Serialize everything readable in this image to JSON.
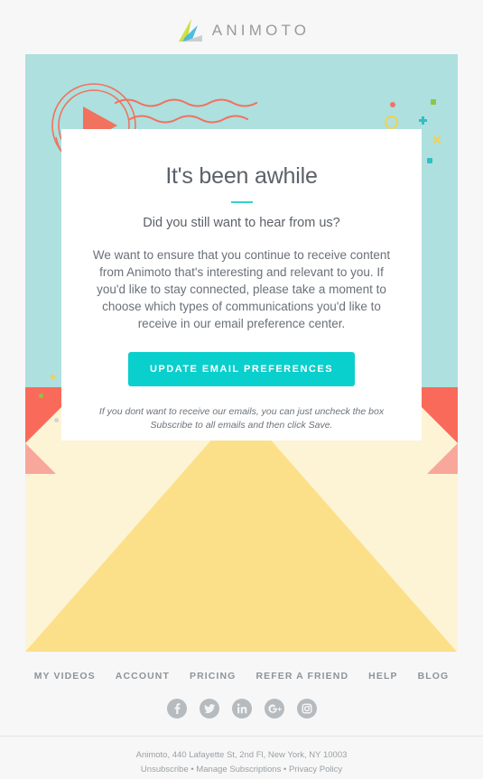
{
  "brand": {
    "name": "ANIMOTO",
    "logo_icon": "animoto-triangle-logo",
    "logo_colors": [
      "#c7dc3f",
      "#3fb6dd",
      "#c9cdd0"
    ]
  },
  "hero": {
    "background_color": "#ade0de",
    "envelope": {
      "body_color": "#fdf4d6",
      "bottom_color": "#fce089",
      "flap_color": "#fa6a5a",
      "flap_shadow_color": "#f9a79b"
    },
    "decor": {
      "play_icon": "play-button-icon",
      "accent_color": "#f0725f",
      "confetti": [
        {
          "name": "coral-dot",
          "color": "#ef7565"
        },
        {
          "name": "green-square",
          "color": "#8dc63f"
        },
        {
          "name": "yellow-ring",
          "color": "#f6d04c"
        },
        {
          "name": "teal-plus",
          "color": "#2fbfc4"
        },
        {
          "name": "yellow-x",
          "color": "#f6d04c"
        },
        {
          "name": "teal-square",
          "color": "#2fbfc4"
        }
      ]
    }
  },
  "card": {
    "title": "It's been awhile",
    "divider_color": "#32d3cd",
    "subtitle": "Did you still want to hear from us?",
    "body": "We want to ensure that you continue to receive content from Animoto that's interesting and relevant to you. If you'd like to stay connected, please take a moment to choose which types of communications you'd like to receive in our email preference center.",
    "cta_label": "UPDATE EMAIL PREFERENCES",
    "cta_color": "#09cfcd",
    "fineprint": "If you dont want to receive our emails, you can just uncheck the box Subscribe to all emails and then click Save."
  },
  "footer": {
    "nav": [
      {
        "label": "MY VIDEOS"
      },
      {
        "label": "ACCOUNT"
      },
      {
        "label": "PRICING"
      },
      {
        "label": "REFER A FRIEND"
      },
      {
        "label": "HELP"
      },
      {
        "label": "BLOG"
      }
    ],
    "social": [
      {
        "name": "facebook-icon",
        "glyph": "f"
      },
      {
        "name": "twitter-icon",
        "glyph": "ᵗ"
      },
      {
        "name": "linkedin-icon",
        "glyph": "in"
      },
      {
        "name": "googleplus-icon",
        "glyph": "g+"
      },
      {
        "name": "instagram-icon",
        "glyph": "▣"
      }
    ],
    "address": "Animoto, 440 Lafayette St, 2nd Fl, New York, NY 10003",
    "legal": {
      "unsubscribe": "Unsubscribe",
      "sep1": " • ",
      "manage": "Manage Subscriptions",
      "sep2": " • ",
      "privacy": "Privacy Policy"
    }
  }
}
